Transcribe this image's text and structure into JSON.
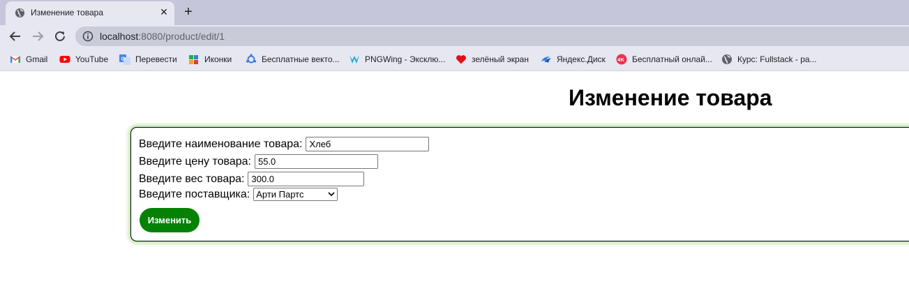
{
  "browser": {
    "tab": {
      "title": "Изменение товара",
      "close": "✕"
    },
    "new_tab": "+",
    "address": {
      "host": "localhost",
      "rest": ":8080/product/edit/1"
    },
    "bookmarks": [
      {
        "label": "Gmail",
        "icon": "gmail-icon"
      },
      {
        "label": "YouTube",
        "icon": "youtube-icon"
      },
      {
        "label": "Перевести",
        "icon": "translate-icon"
      },
      {
        "label": "Иконки",
        "icon": "icons8-icon"
      },
      {
        "label": "Бесплатные векто...",
        "icon": "vector-icon"
      },
      {
        "label": "PNGWing - Эксклю...",
        "icon": "pngwing-icon"
      },
      {
        "label": "зелёный экран",
        "icon": "heart-icon"
      },
      {
        "label": "Яндекс.Диск",
        "icon": "yandex-disk-icon"
      },
      {
        "label": "Бесплатный онлай...",
        "icon": "4k-icon"
      },
      {
        "label": "Курс: Fullstack - ра...",
        "icon": "globe-icon"
      }
    ]
  },
  "page": {
    "title": "Изменение товара",
    "form": {
      "name_label": "Введите наименование товара:",
      "name_value": "Хлеб",
      "price_label": "Введите цену товара:",
      "price_value": "55.0",
      "weight_label": "Введите вес товара:",
      "weight_value": "300.0",
      "supplier_label": "Введите поставщика:",
      "supplier_value": "Арти Партс",
      "submit_label": "Изменить"
    }
  },
  "colors": {
    "submit_bg": "#058205",
    "form_glow": "#b9e6a8"
  }
}
